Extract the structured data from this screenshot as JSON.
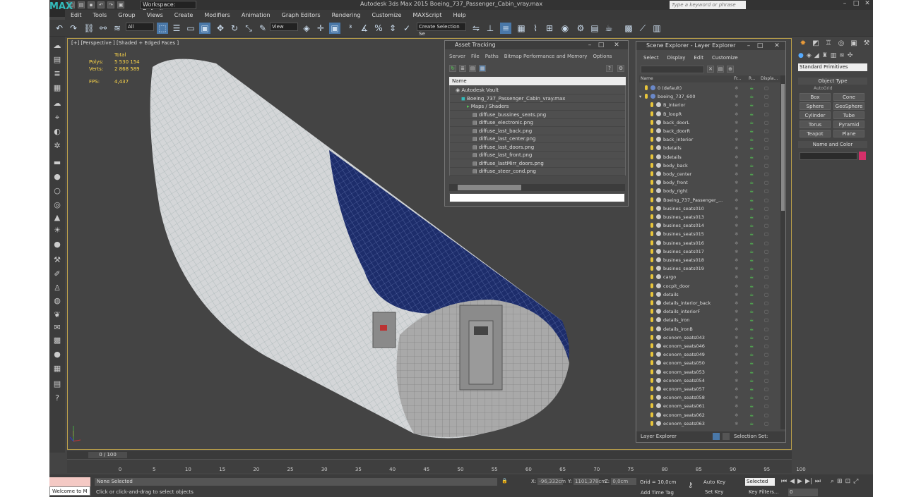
{
  "app": {
    "logo": "MAX",
    "workspace": "Workspace: Default",
    "title": "Autodesk 3ds Max 2015    Boeing_737_Passenger_Cabin_vray.max",
    "search_placeholder": "Type a keyword or phrase"
  },
  "menu": [
    "Edit",
    "Tools",
    "Group",
    "Views",
    "Create",
    "Modifiers",
    "Animation",
    "Graph Editors",
    "Rendering",
    "Customize",
    "MAXScript",
    "Help"
  ],
  "toolbar": {
    "filter": "All",
    "refcoord": "View",
    "selset": "Create Selection Se"
  },
  "viewport": {
    "label": "[+] [Perspective ] [Shaded + Edged Faces ]",
    "stats_header": "Total",
    "polys_label": "Polys:",
    "polys": "5 530 154",
    "verts_label": "Verts:",
    "verts": "2 868 589",
    "fps_label": "FPS:",
    "fps": "4,437"
  },
  "asset": {
    "title": "Asset Tracking",
    "menu": [
      "Server",
      "File",
      "Paths",
      "Bitmap Performance and Memory",
      "Options"
    ],
    "name_header": "Name",
    "rows": [
      {
        "label": "Autodesk Vault",
        "indent": 1,
        "kind": "vault"
      },
      {
        "label": "Boeing_737_Passenger_Cabin_vray.max",
        "indent": 2,
        "kind": "max"
      },
      {
        "label": "Maps / Shaders",
        "indent": 3,
        "kind": "folder"
      },
      {
        "label": "diffuse_bussines_seats.png",
        "indent": 4,
        "kind": "file"
      },
      {
        "label": "diffuse_electronic.png",
        "indent": 4,
        "kind": "file"
      },
      {
        "label": "diffuse_last_back.png",
        "indent": 4,
        "kind": "file"
      },
      {
        "label": "diffuse_last_center.png",
        "indent": 4,
        "kind": "file"
      },
      {
        "label": "diffuse_last_doors.png",
        "indent": 4,
        "kind": "file"
      },
      {
        "label": "diffuse_last_front.png",
        "indent": 4,
        "kind": "file"
      },
      {
        "label": "diffuse_lastMirr_doors.png",
        "indent": 4,
        "kind": "file"
      },
      {
        "label": "diffuse_steer_cond.png",
        "indent": 4,
        "kind": "file"
      }
    ]
  },
  "scene": {
    "title": "Scene Explorer - Layer Explorer",
    "menu": [
      "Select",
      "Display",
      "Edit",
      "Customize"
    ],
    "headers": {
      "name": "Name",
      "c1": "Fr...",
      "c2": "R...",
      "c3": "Displa..."
    },
    "rows": [
      {
        "label": "0 (default)",
        "level": 0
      },
      {
        "label": "boeing_737_600",
        "level": 0
      },
      {
        "label": "B_interior",
        "level": 1
      },
      {
        "label": "B_loopR",
        "level": 1
      },
      {
        "label": "back_doorL",
        "level": 1
      },
      {
        "label": "back_doorR",
        "level": 1
      },
      {
        "label": "back_interior",
        "level": 1
      },
      {
        "label": "bdetails",
        "level": 1
      },
      {
        "label": "bdetails",
        "level": 1
      },
      {
        "label": "body_back",
        "level": 1
      },
      {
        "label": "body_center",
        "level": 1
      },
      {
        "label": "body_front",
        "level": 1
      },
      {
        "label": "body_right",
        "level": 1
      },
      {
        "label": "Boeing_737_Passenger_...",
        "level": 1
      },
      {
        "label": "busines_seats010",
        "level": 1
      },
      {
        "label": "busines_seats013",
        "level": 1
      },
      {
        "label": "busines_seats014",
        "level": 1
      },
      {
        "label": "busines_seats015",
        "level": 1
      },
      {
        "label": "busines_seats016",
        "level": 1
      },
      {
        "label": "busines_seats017",
        "level": 1
      },
      {
        "label": "busines_seats018",
        "level": 1
      },
      {
        "label": "busines_seats019",
        "level": 1
      },
      {
        "label": "cargo",
        "level": 1
      },
      {
        "label": "cocpit_door",
        "level": 1
      },
      {
        "label": "details",
        "level": 1
      },
      {
        "label": "details_interior_back",
        "level": 1
      },
      {
        "label": "details_interiorF",
        "level": 1
      },
      {
        "label": "details_iron",
        "level": 1
      },
      {
        "label": "details_ironB",
        "level": 1
      },
      {
        "label": "econom_seats043",
        "level": 1
      },
      {
        "label": "econom_seats046",
        "level": 1
      },
      {
        "label": "econom_seats049",
        "level": 1
      },
      {
        "label": "econom_seats050",
        "level": 1
      },
      {
        "label": "econom_seats053",
        "level": 1
      },
      {
        "label": "econom_seats054",
        "level": 1
      },
      {
        "label": "econom_seats057",
        "level": 1
      },
      {
        "label": "econom_seats058",
        "level": 1
      },
      {
        "label": "econom_seats061",
        "level": 1
      },
      {
        "label": "econom_seats062",
        "level": 1
      },
      {
        "label": "econom_seats063",
        "level": 1
      }
    ],
    "footer_left": "Layer Explorer",
    "footer_right": "Selection Set:"
  },
  "cmd": {
    "dropdown": "Standard Primitives",
    "object_type": "Object Type",
    "autogrid": "AutoGrid",
    "prims": [
      "Box",
      "Cone",
      "Sphere",
      "GeoSphere",
      "Cylinder",
      "Tube",
      "Torus",
      "Pyramid",
      "Teapot",
      "Plane"
    ],
    "name_color": "Name and Color",
    "swatch": "#d6306a"
  },
  "time": {
    "slider": "0 / 100",
    "ticks": [
      "0",
      "5",
      "10",
      "15",
      "20",
      "25",
      "30",
      "35",
      "40",
      "45",
      "50",
      "55",
      "60",
      "65",
      "70",
      "75",
      "80",
      "85",
      "90",
      "95",
      "100"
    ]
  },
  "status": {
    "welcome": "Welcome to M",
    "selection": "None Selected",
    "prompt": "Click or click-and-drag to select objects",
    "x_label": "X:",
    "x": "-96,332cm",
    "y_label": "Y:",
    "y": "1101,378cm",
    "z_label": "Z:",
    "z": "0,0cm",
    "grid": "Grid = 10,0cm",
    "addtag": "Add Time Tag",
    "autokey": "Auto Key",
    "setkey": "Set Key",
    "selected": "Selected",
    "keyfilters": "Key Filters...",
    "frame": "0"
  }
}
